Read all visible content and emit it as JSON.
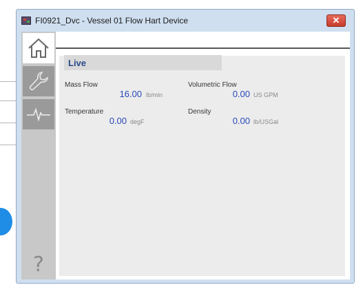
{
  "window": {
    "title": "FI0921_Dvc - Vessel 01 Flow Hart Device",
    "close_glyph": "✕"
  },
  "sidebar": {
    "items": [
      {
        "icon": "home-icon"
      },
      {
        "icon": "wrench-icon"
      },
      {
        "icon": "trend-icon"
      },
      {
        "icon": "help-icon",
        "glyph": "?"
      }
    ]
  },
  "section": {
    "title": "Live"
  },
  "fields": [
    {
      "label": "Mass Flow",
      "value": "16.00",
      "unit": "lb/min"
    },
    {
      "label": "Volumetric Flow",
      "value": "0.00",
      "unit": "US GPM"
    },
    {
      "label": "Temperature",
      "value": "0.00",
      "unit": "degF"
    },
    {
      "label": "Density",
      "value": "0.00",
      "unit": "lb/USGal"
    }
  ],
  "colors": {
    "value_blue": "#2848b8",
    "close_red": "#c53b2a",
    "title_blue": "#2a4a8a"
  }
}
